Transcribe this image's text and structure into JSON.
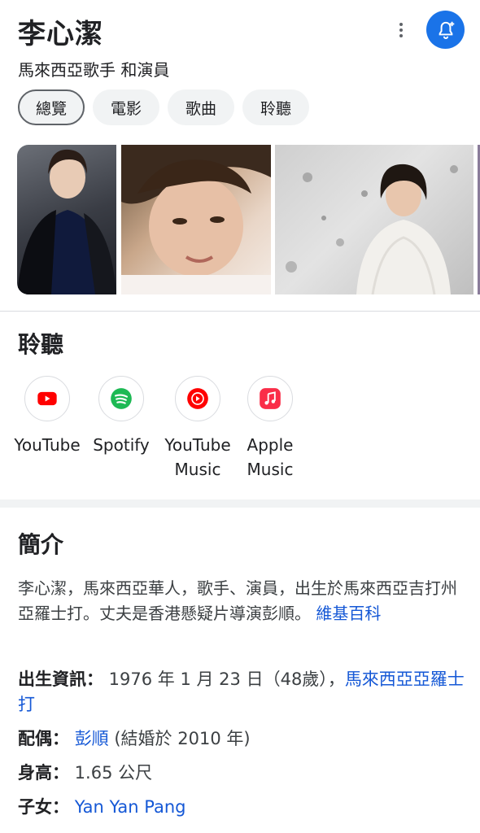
{
  "header": {
    "title": "李心潔",
    "subtitle": "馬來西亞歌手 和演員"
  },
  "tabs": [
    {
      "label": "總覽",
      "active": true
    },
    {
      "label": "電影",
      "active": false
    },
    {
      "label": "歌曲",
      "active": false
    },
    {
      "label": "聆聽",
      "active": false
    }
  ],
  "listen": {
    "title": "聆聽",
    "services": [
      {
        "name": "YouTube",
        "icon": "youtube-icon",
        "color": "#ff0000"
      },
      {
        "name": "Spotify",
        "icon": "spotify-icon",
        "color": "#1db954"
      },
      {
        "name": "YouTube Music",
        "icon": "youtube-music-icon",
        "color": "#ff0000"
      },
      {
        "name": "Apple Music",
        "icon": "apple-music-icon",
        "color": "#fa2d48"
      }
    ]
  },
  "intro": {
    "title": "簡介",
    "text": "李心潔，馬來西亞華人，歌手、演員，出生於馬來西亞吉打州亞羅士打。丈夫是香港懸疑片導演彭順。",
    "source_link": "維基百科"
  },
  "facts": {
    "birth": {
      "label": "出生資訊：",
      "value": " 1976 年 1 月 23 日（48歲）",
      "sep": "，",
      "place": "馬來西亞亞羅士打"
    },
    "spouse": {
      "label": "配偶：",
      "value": "彭順",
      "extra": " (結婚於 2010 年)"
    },
    "height": {
      "label": "身高：",
      "value": " 1.65 公尺"
    },
    "children": {
      "label": "子女：",
      "value": "Yan Yan Pang"
    }
  },
  "colors": {
    "accent": "#1a73e8",
    "link": "#1558d6"
  }
}
